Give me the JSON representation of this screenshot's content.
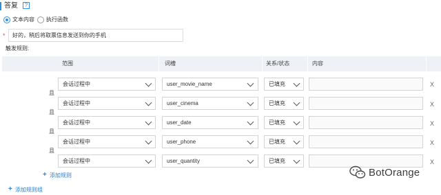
{
  "answer": {
    "title": "答复",
    "help_icon": "?",
    "options": [
      {
        "label": "文本内容",
        "selected": true
      },
      {
        "label": "执行函数",
        "selected": false
      }
    ],
    "required_mark": "*",
    "reply_text": "好的，稍后将取票信息发送到你的手机"
  },
  "trigger_rules": {
    "label": "触发规则:",
    "headers": {
      "scope": "范围",
      "slot": "词槽",
      "relation": "关系/状态",
      "content": "内容"
    },
    "connector": "且",
    "rows": [
      {
        "scope": "会话过程中",
        "slot": "user_movie_name",
        "relation": "已填充",
        "content": ""
      },
      {
        "scope": "会话过程中",
        "slot": "user_cinema",
        "relation": "已填充",
        "content": ""
      },
      {
        "scope": "会话过程中",
        "slot": "user_date",
        "relation": "已填充",
        "content": ""
      },
      {
        "scope": "会话过程中",
        "slot": "user_phone",
        "relation": "已填充",
        "content": ""
      },
      {
        "scope": "会话过程中",
        "slot": "user_quantity",
        "relation": "已填充",
        "content": ""
      }
    ],
    "delete_label": "X",
    "add_rule": "添加规则",
    "add_rule_group": "添加规则组"
  },
  "watermark": {
    "text": "BotOrange",
    "icon": "wechat-icon"
  },
  "colors": {
    "accent": "#2b8fe0",
    "link": "#2b7fd1",
    "header_bg": "#eef1f5",
    "required": "#e64c4c"
  }
}
